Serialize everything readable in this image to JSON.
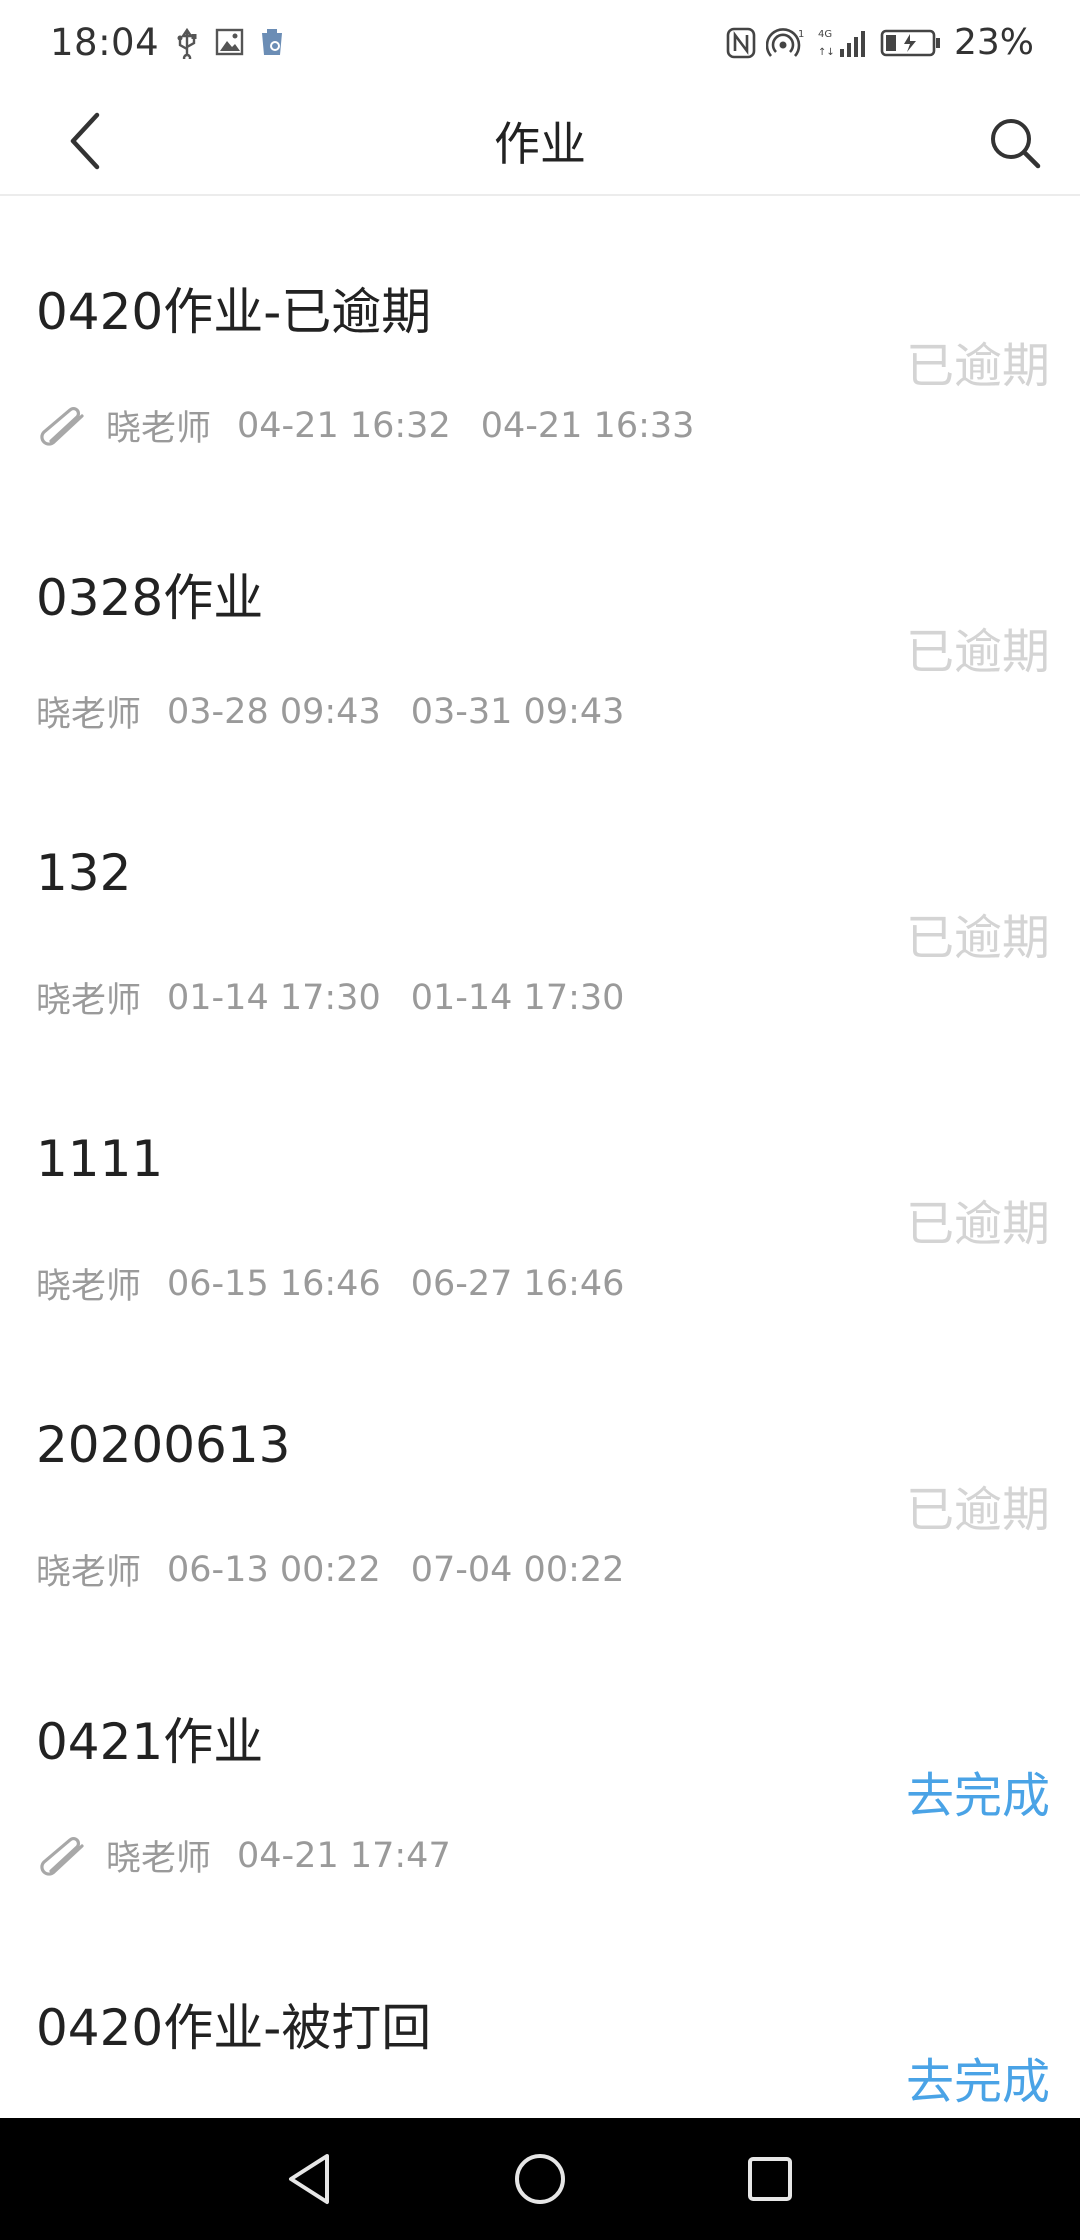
{
  "status_bar": {
    "time": "18:04",
    "left_icons": [
      "usb-icon",
      "image-icon",
      "cleaner-icon"
    ],
    "right_icons": [
      "nfc-icon",
      "hotspot-icon",
      "signal-4g-icon",
      "battery-charging-icon"
    ],
    "battery": "23%"
  },
  "header": {
    "title": "作业",
    "back_icon": "chevron-left-icon",
    "search_icon": "search-icon"
  },
  "assignments": [
    {
      "title": "0420作业-已逾期",
      "has_attachment": true,
      "teacher": "晓老师",
      "start": "04-21 16:32",
      "end": "04-21 16:33",
      "status": "已逾期",
      "status_type": "overdue"
    },
    {
      "title": "0328作业",
      "has_attachment": false,
      "teacher": "晓老师",
      "start": "03-28 09:43",
      "end": "03-31 09:43",
      "status": "已逾期",
      "status_type": "overdue"
    },
    {
      "title": "132",
      "has_attachment": false,
      "teacher": "晓老师",
      "start": "01-14 17:30",
      "end": "01-14 17:30",
      "status": "已逾期",
      "status_type": "overdue"
    },
    {
      "title": "1111",
      "has_attachment": false,
      "teacher": "晓老师",
      "start": "06-15 16:46",
      "end": "06-27 16:46",
      "status": "已逾期",
      "status_type": "overdue"
    },
    {
      "title": "20200613",
      "has_attachment": false,
      "teacher": "晓老师",
      "start": "06-13 00:22",
      "end": "07-04 00:22",
      "status": "已逾期",
      "status_type": "overdue"
    },
    {
      "title": "0421作业",
      "has_attachment": true,
      "teacher": "晓老师",
      "start": "04-21 17:47",
      "end": "",
      "status": "去完成",
      "status_type": "todo"
    },
    {
      "title": "0420作业-被打回",
      "has_attachment": true,
      "teacher": "",
      "start": "",
      "end": "",
      "status": "去完成",
      "status_type": "todo"
    }
  ],
  "colors": {
    "overdue": "#d4d4d4",
    "todo": "#4aa3e6",
    "meta": "#9a9a9a"
  },
  "nav_bar": {
    "icons": [
      "back-triangle-icon",
      "home-circle-icon",
      "recents-square-icon"
    ]
  }
}
